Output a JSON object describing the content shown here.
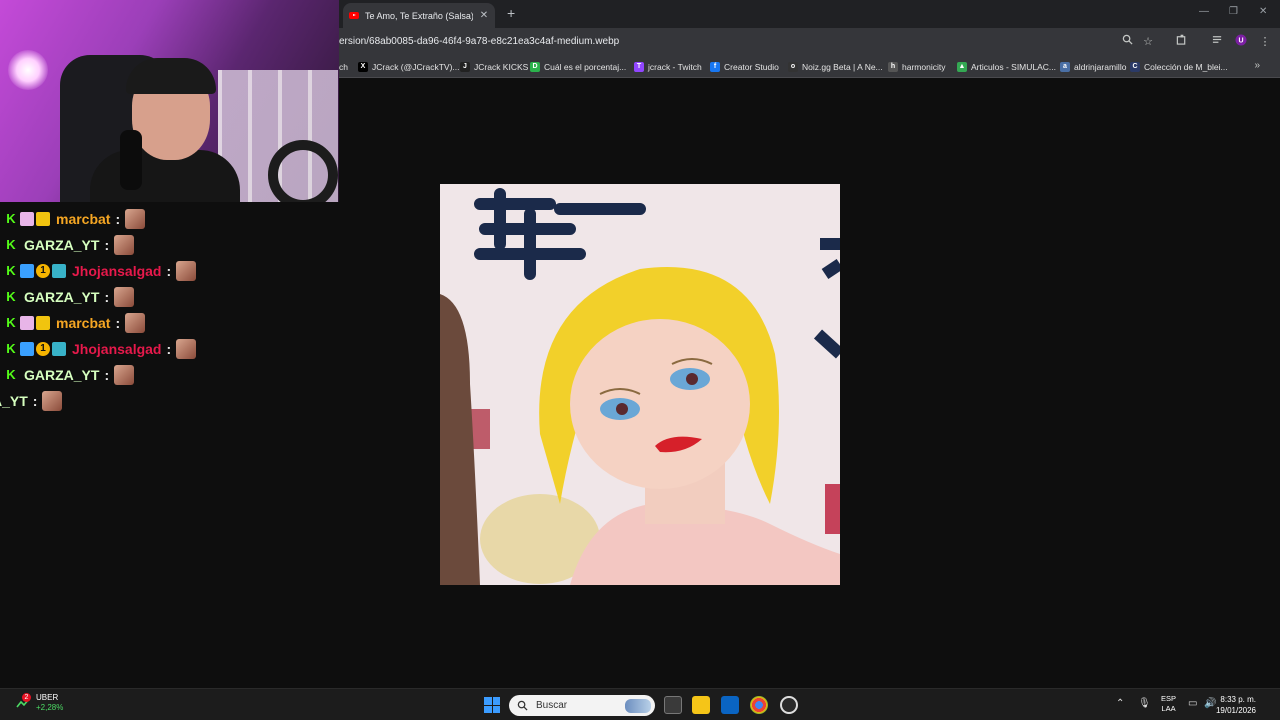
{
  "browser": {
    "tab_title": "Te Amo, Te Extraño (Salsa) - Yo",
    "tab_close": "✕",
    "new_tab": "+",
    "url": "ersion/68ab0085-da96-46f4-9a78-e8c21ea3c4af-medium.webp",
    "window_controls": [
      "—",
      "❐",
      "✕"
    ],
    "toolbar_icons": [
      "zoom-icon",
      "star-icon",
      "extensions-icon",
      "tab-search-icon",
      "profile-icon",
      "menu-icon"
    ]
  },
  "bookmarks": [
    {
      "label": "ch",
      "icon": ""
    },
    {
      "label": "JCrack (@JCrackTV)...",
      "icon": "X",
      "color": "#000000"
    },
    {
      "label": "JCrack KICKS",
      "icon": "J",
      "color": "#222222"
    },
    {
      "label": "Cuál es el porcentaj...",
      "icon": "D",
      "color": "#2bb24c"
    },
    {
      "label": "jcrack - Twitch",
      "icon": "T",
      "color": "#9146ff"
    },
    {
      "label": "Creator Studio",
      "icon": "f",
      "color": "#1877f2"
    },
    {
      "label": "Noiz.gg Beta | A Ne...",
      "icon": "o",
      "color": "#333333"
    },
    {
      "label": "harmonicity",
      "icon": "h",
      "color": "#555555"
    },
    {
      "label": "Articulos - SIMULAC...",
      "icon": "▲",
      "color": "#34a853"
    },
    {
      "label": "aldrinjaramillo",
      "icon": "a",
      "color": "#4a6fa5"
    },
    {
      "label": "Colección de M_blei...",
      "icon": "C",
      "color": "#2b3a67"
    }
  ],
  "bookmarks_more": "»",
  "chat": [
    {
      "user": "marcbat",
      "color": "#f5a623",
      "badges": [
        "k",
        "mod",
        "crown"
      ]
    },
    {
      "user": "GARZA_YT",
      "color": "#d6ffbf",
      "badges": [
        "k"
      ]
    },
    {
      "user": "Jhojansalgad",
      "color": "#e6194b",
      "badges": [
        "k",
        "x",
        "one",
        "grid"
      ]
    },
    {
      "user": "GARZA_YT",
      "color": "#d6ffbf",
      "badges": [
        "k"
      ]
    },
    {
      "user": "marcbat",
      "color": "#f5a623",
      "badges": [
        "k",
        "mod",
        "crown"
      ]
    },
    {
      "user": "Jhojansalgad",
      "color": "#e6194b",
      "badges": [
        "k",
        "x",
        "one",
        "grid"
      ]
    },
    {
      "user": "GARZA_YT",
      "color": "#d6ffbf",
      "badges": [
        "k"
      ]
    },
    {
      "user": "A_YT",
      "color": "#d6ffbf",
      "badges": []
    }
  ],
  "chat_colon": ":",
  "taskbar": {
    "weather_badge": "2",
    "weather_name": "UBER",
    "weather_change": "+2,28%",
    "search_placeholder": "Buscar",
    "lang_line1": "ESP",
    "lang_line2": "LAA",
    "time": "8:33 p. m.",
    "date": "19/01/2026"
  }
}
